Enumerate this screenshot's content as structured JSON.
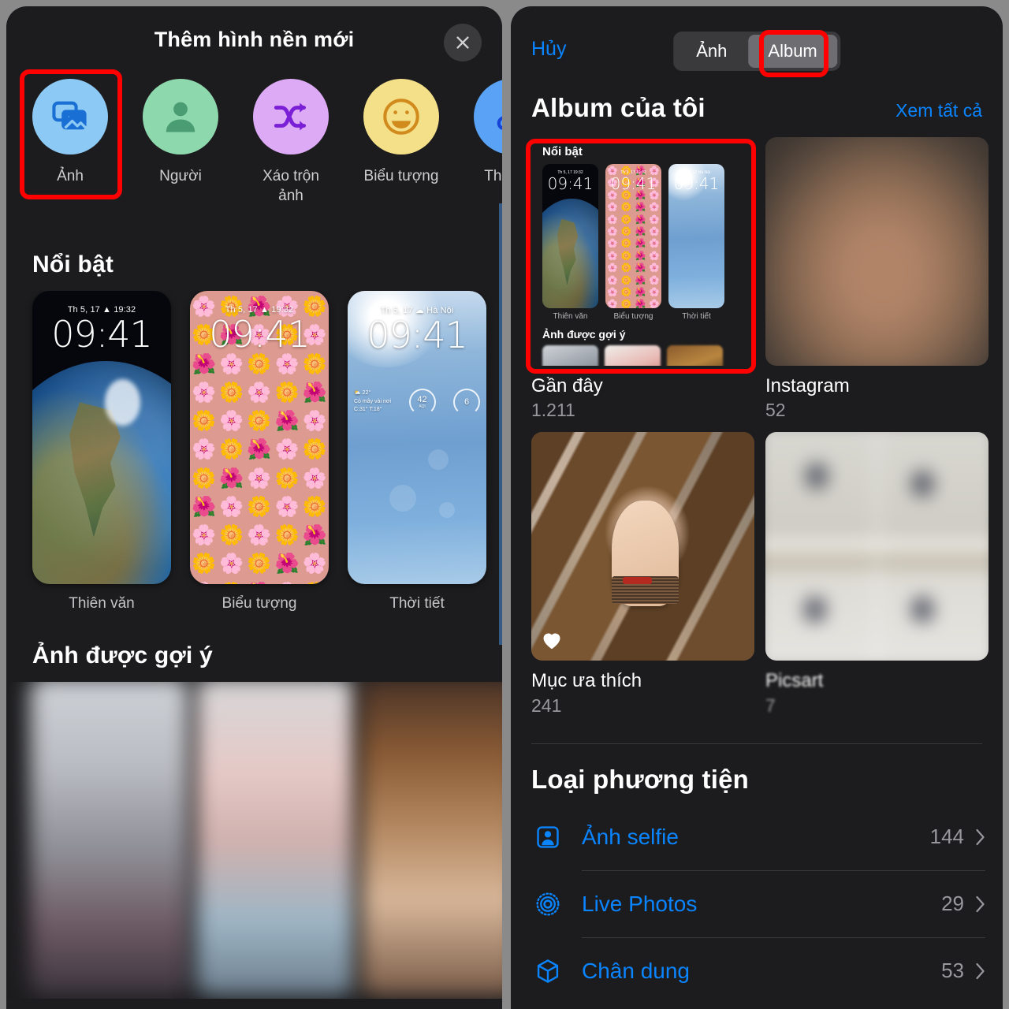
{
  "left_panel": {
    "title": "Thêm hình nền mới",
    "close_icon": "close-icon",
    "categories": [
      {
        "label": "Ảnh",
        "icon": "photos-icon",
        "circle_color": "#8ccaf5",
        "glyph_color": "#1a6fd4"
      },
      {
        "label": "Người",
        "icon": "person-icon",
        "circle_color": "#8ed8ae",
        "glyph_color": "#4a9c72"
      },
      {
        "label": "Xáo trộn ảnh",
        "icon": "shuffle-icon",
        "circle_color": "#ddaaf5",
        "glyph_color": "#7a1fd6"
      },
      {
        "label": "Biểu tượng",
        "icon": "emoji-icon",
        "circle_color": "#f5e08a",
        "glyph_color": "#d18a1c"
      },
      {
        "label": "Thời tiết",
        "icon": "weather-icon",
        "circle_color": "#5aa2f5",
        "glyph_color": "#1544d6"
      }
    ],
    "featured_section_title": "Nổi bật",
    "featured": [
      {
        "name": "Thiên văn",
        "time": "09:41",
        "date": "Th 5, 17",
        "meta": "19:32"
      },
      {
        "name": "Biểu tượng",
        "time": "09:41",
        "date": "Th 5, 17",
        "meta": "19:32"
      },
      {
        "name": "Thời tiết",
        "time": "09:41",
        "date": "Th 5, 17",
        "meta": "Hà Nội",
        "temp": "22°",
        "cond": "Có mây vài nơi",
        "hilo": "C:31° T:18°",
        "ring1": "42",
        "ring1_sub": "AQI",
        "ring2": "6"
      }
    ],
    "suggested_section_title": "Ảnh được gợi ý"
  },
  "right_panel": {
    "cancel_label": "Hủy",
    "segments": [
      {
        "label": "Ảnh",
        "active": false
      },
      {
        "label": "Album",
        "active": true
      }
    ],
    "my_albums_title": "Album của tôi",
    "see_all_label": "Xem tất cả",
    "albums": [
      {
        "name": "Gần đây",
        "count": "1.211",
        "thumb": "nested-album-screenshot",
        "blurry": false
      },
      {
        "name": "Instagram",
        "count": "52",
        "thumb": "blurred-photo",
        "blurry": false
      },
      {
        "name": "Mục ưa thích",
        "count": "241",
        "thumb": "hand-bracelet-photo",
        "blurry": false
      },
      {
        "name": "Picsart",
        "count": "7",
        "thumb": "blurred-grid",
        "blurry": true
      }
    ],
    "nested_thumb": {
      "featured_title": "Nổi bật",
      "items": [
        {
          "label": "Thiên văn",
          "time": "09:41",
          "date": "Th 5, 17  19:32"
        },
        {
          "label": "Biểu tượng",
          "time": "09:41",
          "date": "Th 5, 17  19:32"
        },
        {
          "label": "Thời tiết",
          "time": "09:41",
          "date": "Th 5, 17  Hà Nội"
        }
      ],
      "suggested_title": "Ảnh được gợi ý"
    },
    "media_type_title": "Loại phương tiện",
    "media_types": [
      {
        "label": "Ảnh selfie",
        "count": "144",
        "icon": "selfie-icon"
      },
      {
        "label": "Live Photos",
        "count": "29",
        "icon": "live-photo-icon"
      },
      {
        "label": "Chân dung",
        "count": "53",
        "icon": "portrait-cube-icon"
      }
    ]
  },
  "annotations": {
    "highlight_color": "#ff0000",
    "boxes": [
      "photos-category",
      "album-segment-tab",
      "recent-album-thumb"
    ]
  },
  "theme": {
    "background": "#1c1c1e",
    "accent_blue": "#0a84ff",
    "secondary_text": "#98989d",
    "frame_gray": "#8a8a8a"
  }
}
